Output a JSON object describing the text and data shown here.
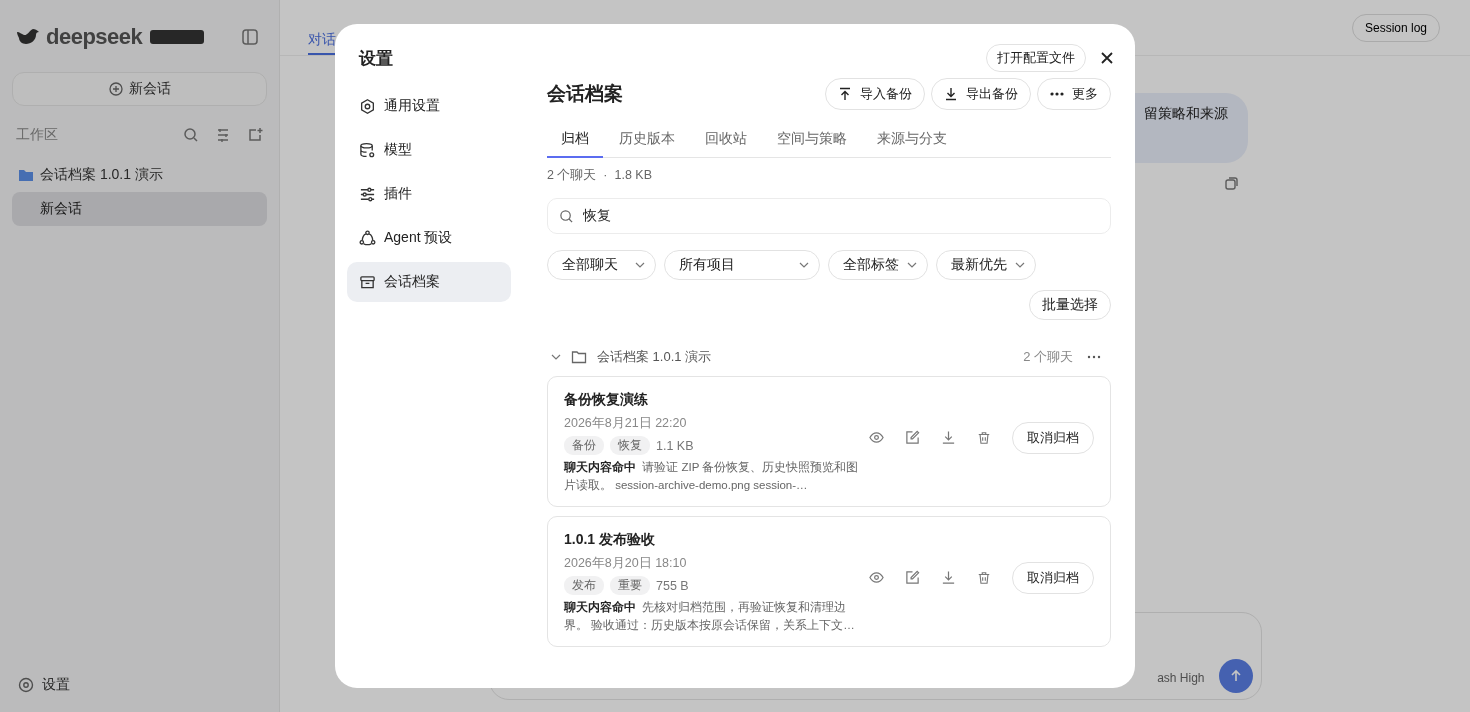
{
  "app": {
    "logo": "deepseek",
    "new_chat": "新会话",
    "workspace_label": "工作区",
    "project": "会话档案 1.0.1 演示",
    "chats": [
      {
        "title": "新会话",
        "selected": true
      }
    ],
    "settings": "设置",
    "tab": "对话",
    "session_log": "Session log",
    "bubble": "留策略和来源",
    "model_partial": "ash High"
  },
  "modal": {
    "title": "设置",
    "open_config": "打开配置文件",
    "nav": [
      {
        "label": "通用设置",
        "kind": "gear",
        "selected": false
      },
      {
        "label": "模型",
        "kind": "database",
        "selected": false
      },
      {
        "label": "插件",
        "kind": "sliders",
        "selected": false
      },
      {
        "label": "Agent 预设",
        "kind": "agent",
        "selected": false
      },
      {
        "label": "会话档案",
        "kind": "archive",
        "selected": true
      }
    ],
    "heading": "会话档案",
    "actions": [
      {
        "label": "导入备份",
        "kind": "upload"
      },
      {
        "label": "导出备份",
        "kind": "download"
      },
      {
        "label": "更多",
        "kind": "more"
      }
    ],
    "tabs": [
      {
        "label": "归档",
        "selected": true
      },
      {
        "label": "历史版本",
        "selected": false
      },
      {
        "label": "回收站",
        "selected": false
      },
      {
        "label": "空间与策略",
        "selected": false
      },
      {
        "label": "来源与分支",
        "selected": false
      }
    ],
    "stats": "2 个聊天  ·  1.8 KB",
    "search": {
      "value": "恢复"
    },
    "filters": [
      {
        "label": "全部聊天"
      },
      {
        "label": "所有项目"
      },
      {
        "label": "全部标签"
      },
      {
        "label": "最新优先"
      }
    ],
    "batch": "批量选择",
    "group": {
      "name": "会话档案 1.0.1 演示",
      "count": "2 个聊天",
      "expanded": true,
      "cards": [
        {
          "title": "备份恢复演练",
          "date": "2026年8月21日 22:20",
          "tags": [
            "备份",
            "恢复"
          ],
          "size": "1.1 KB",
          "match": "聊天内容命中",
          "snippet": "请验证 ZIP 备份恢复、历史快照预览和图片读取。 session-archive-demo.png session-…",
          "button": "取消归档"
        },
        {
          "title": "1.0.1 发布验收",
          "date": "2026年8月20日 18:10",
          "tags": [
            "发布",
            "重要"
          ],
          "size": "755 B",
          "match": "聊天内容命中",
          "snippet": "先核对归档范围，再验证恢复和清理边界。 验收通过：历史版本按原会话保留，关系上下文…",
          "button": "取消归档"
        }
      ]
    }
  }
}
